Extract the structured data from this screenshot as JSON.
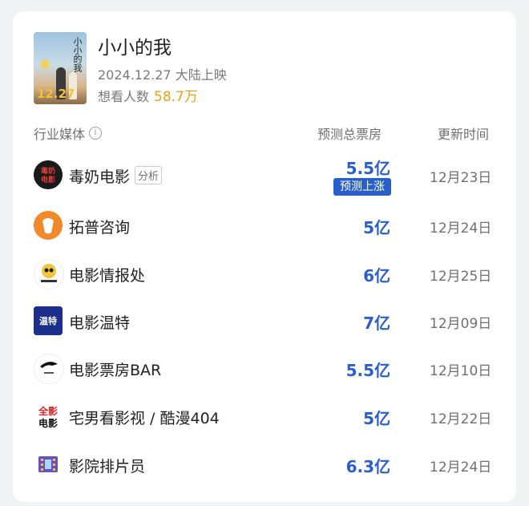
{
  "movie": {
    "title": "小小的我",
    "release": "2024.12.27 大陆上映",
    "want_label": "想看人数",
    "want_count": "58.7万",
    "poster_date": "12.27",
    "poster_text": "小小的我"
  },
  "headers": {
    "media": "行业媒体",
    "info_icon": "i",
    "prediction": "预测总票房",
    "updated": "更新时间"
  },
  "rows": [
    {
      "name": "毒奶电影",
      "tag": "分析",
      "value": "5.5亿",
      "badge": "预测上涨",
      "date": "12月23日",
      "logo_text": "毒奶电影",
      "icon": "dunai-logo-icon"
    },
    {
      "name": "拓普咨询",
      "value": "5亿",
      "date": "12月24日",
      "icon": "topu-logo-icon"
    },
    {
      "name": "电影情报处",
      "value": "6亿",
      "date": "12月25日",
      "icon": "qingbaochu-logo-icon"
    },
    {
      "name": "电影温特",
      "value": "7亿",
      "date": "12月09日",
      "logo_text": "温特",
      "icon": "wente-logo-icon"
    },
    {
      "name": "电影票房BAR",
      "value": "5.5亿",
      "date": "12月10日",
      "icon": "piaofang-bar-logo-icon"
    },
    {
      "name": "宅男看影视 / 酷漫404",
      "value": "5亿",
      "date": "12月22日",
      "logo_text": "全影电影",
      "icon": "zhainan-logo-icon"
    },
    {
      "name": "影院排片员",
      "value": "6.3亿",
      "date": "12月24日",
      "icon": "paipian-logo-icon"
    }
  ],
  "colors": {
    "accent": "#2a5fc9",
    "want": "#e8a317"
  }
}
